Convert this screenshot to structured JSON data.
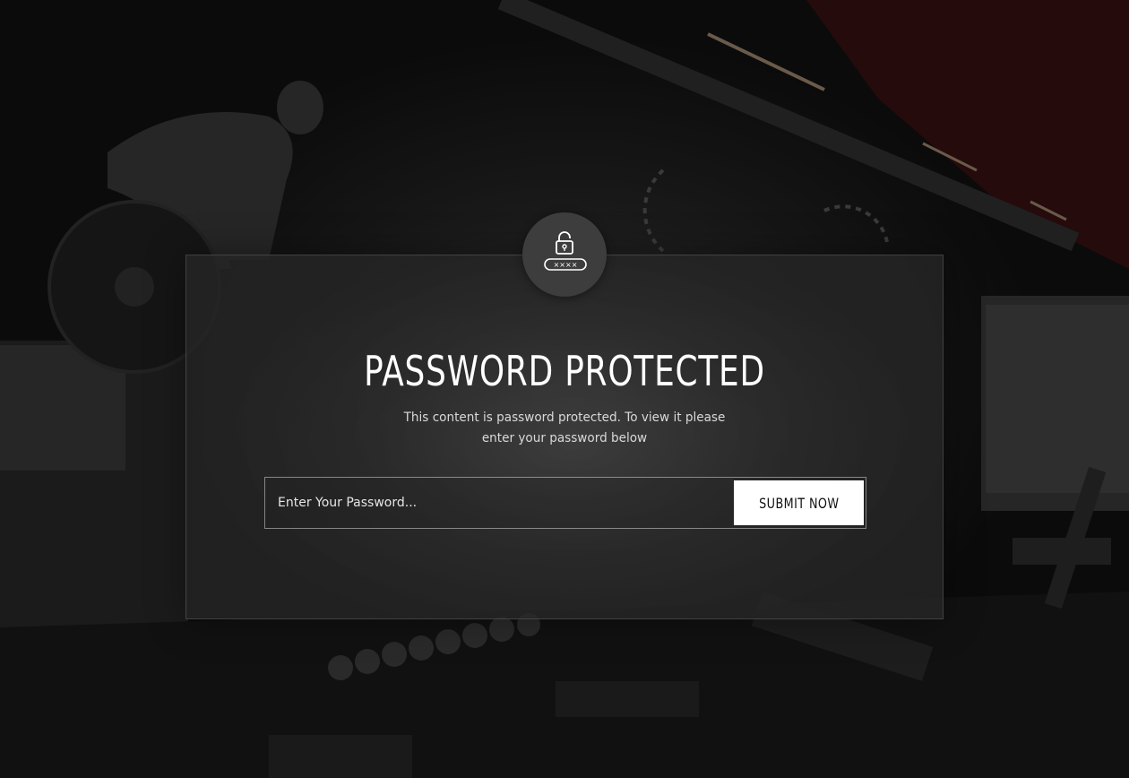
{
  "page": {
    "title": "PASSWORD PROTECTED",
    "subtitle_line1": "This content is password protected. To view it please",
    "subtitle_line2": "enter your password below"
  },
  "form": {
    "password_placeholder": "Enter Your Password...",
    "password_value": "",
    "submit_label": "SUBMIT NOW"
  },
  "icons": {
    "badge": "padlock-password-icon",
    "mask_text": "××××"
  },
  "colors": {
    "background": "#0c0c0c",
    "card": "#2f2f2f",
    "badge": "#3d3d3d",
    "button": "#ffffff",
    "button_text": "#111111",
    "title_text": "#ffffff"
  }
}
